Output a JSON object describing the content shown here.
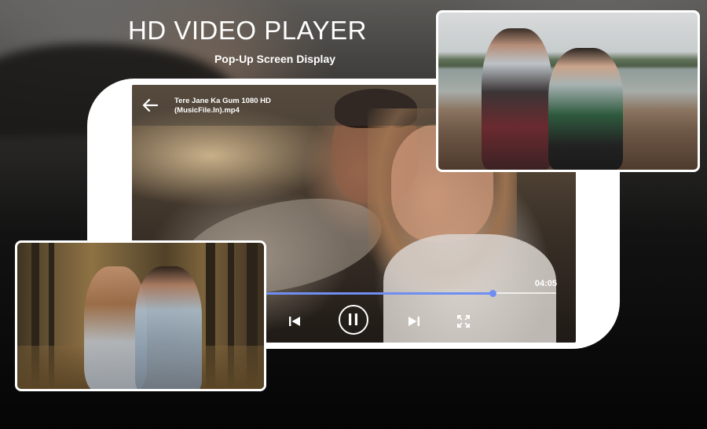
{
  "promo": {
    "headline": "HD VIDEO PLAYER",
    "subheadline": "Pop-Up Screen Display"
  },
  "player": {
    "video_title": "Tere Jane Ka Gum 1080 HD (MusicFile.In).mp4",
    "current_time": "04:05",
    "progress": 0.78,
    "accent_color": "#6f8ef2",
    "icons": {
      "back": "arrow-left-icon",
      "previous": "skip-previous-icon",
      "pause": "pause-icon",
      "next": "skip-next-icon",
      "fullscreen": "fullscreen-icon"
    }
  }
}
